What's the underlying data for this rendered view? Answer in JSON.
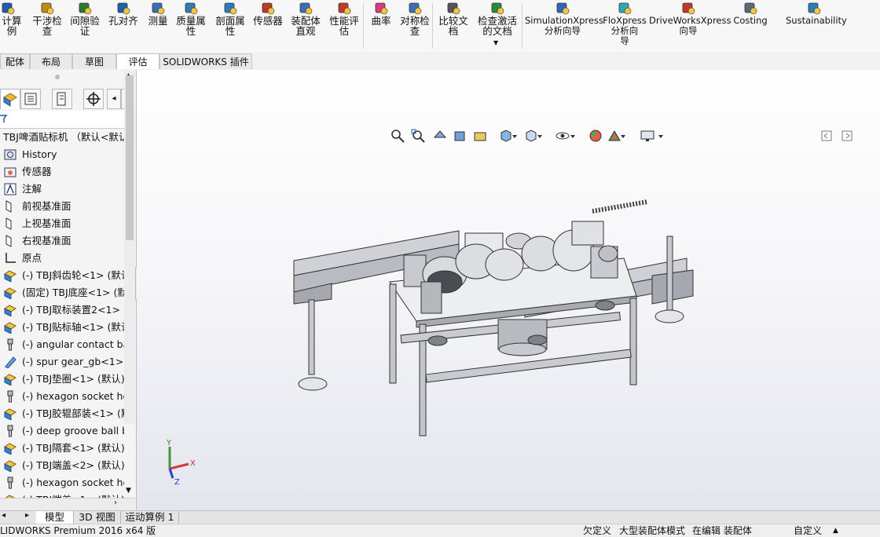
{
  "ribbon": {
    "items": [
      {
        "label": "计算\n例",
        "icon": "calc-icon",
        "color": "#1c5fae"
      },
      {
        "label": "干涉检\n查",
        "icon": "interference-icon",
        "color": "#c48a14"
      },
      {
        "label": "间隙验\n证",
        "icon": "clearance-icon",
        "color": "#2c7a2c"
      },
      {
        "label": "孔对齐",
        "icon": "hole-align-icon",
        "color": "#1c5fae"
      },
      {
        "label": "测量",
        "icon": "measure-icon",
        "color": "#3a6fb8"
      },
      {
        "label": "质量属\n性",
        "icon": "mass-properties-icon",
        "color": "#2c7ab8"
      },
      {
        "label": "剖面属\n性",
        "icon": "section-properties-icon",
        "color": "#2c7ab8"
      },
      {
        "label": "传感器",
        "icon": "sensor-icon",
        "color": "#b83c2c"
      },
      {
        "label": "装配体\n直观",
        "icon": "assembly-visualization-icon",
        "color": "#3a6fb8"
      },
      {
        "label": "性能评\n估",
        "icon": "performance-icon",
        "color": "#c0392b"
      },
      {
        "label": "曲率",
        "icon": "curvature-icon",
        "color": "#d83c7a"
      },
      {
        "label": "对称检\n查",
        "icon": "symmetry-check-icon",
        "color": "#3a6fb8"
      },
      {
        "label": "比较文\n档",
        "icon": "compare-documents-icon",
        "color": "#555555"
      },
      {
        "label": "检查激活\n的文档",
        "icon": "check-active-document-icon",
        "color": "#2c8a3c"
      },
      {
        "label": "SimulationXpress\n分析向导",
        "icon": "simulationxpress-icon",
        "color": "#2c6ab8"
      },
      {
        "label": "FloXpress\n分析向\n导",
        "icon": "floxpress-icon",
        "color": "#2ca8b8"
      },
      {
        "label": "DriveWorksXpress\n向导",
        "icon": "driveworksxpress-icon",
        "color": "#c0392b"
      },
      {
        "label": "Costing",
        "icon": "costing-icon",
        "color": "#5a6a7a"
      },
      {
        "label": "Sustainability",
        "icon": "sustainability-icon",
        "color": "#2c7ab8"
      }
    ]
  },
  "command_tabs": [
    "配体",
    "布局",
    "草图",
    "评估",
    "SOLIDWORKS 插件"
  ],
  "active_tab": "评估",
  "tree": {
    "root": "TBJ啤酒贴标机 （默认<默认_",
    "items": [
      {
        "label": "History",
        "icon": "history-icon"
      },
      {
        "label": "传感器",
        "icon": "sensor-folder-icon"
      },
      {
        "label": "注解",
        "icon": "annotations-icon"
      },
      {
        "label": "前视基准面",
        "icon": "plane-icon"
      },
      {
        "label": "上视基准面",
        "icon": "plane-icon"
      },
      {
        "label": "右视基准面",
        "icon": "plane-icon"
      },
      {
        "label": "原点",
        "icon": "origin-icon"
      },
      {
        "label": "(-) TBJ斜齿轮<1> (默认",
        "icon": "subassembly-icon"
      },
      {
        "label": "(固定) TBJ底座<1> (默认",
        "icon": "subassembly-icon"
      },
      {
        "label": "(-) TBJ取标装置2<1> (默",
        "icon": "subassembly-icon"
      },
      {
        "label": "(-) TBJ贴标轴<1> (默认",
        "icon": "subassembly-icon"
      },
      {
        "label": "(-) angular contact bal",
        "icon": "toolbox-part-icon"
      },
      {
        "label": "(-) spur gear_gb<1> (",
        "icon": "toolbox-gear-icon"
      },
      {
        "label": "(-) TBJ垫圈<1> (默认)",
        "icon": "subassembly-icon"
      },
      {
        "label": "(-) hexagon socket hea",
        "icon": "toolbox-part-icon"
      },
      {
        "label": "(-) TBJ胶辊部装<1> (默",
        "icon": "subassembly-icon"
      },
      {
        "label": "(-) deep groove ball b",
        "icon": "toolbox-part-icon"
      },
      {
        "label": "(-) TBJ隔套<1> (默认)",
        "icon": "subassembly-icon"
      },
      {
        "label": "(-) TBJ端盖<2> (默认)",
        "icon": "subassembly-icon"
      },
      {
        "label": "(-) hexagon socket hea",
        "icon": "toolbox-part-icon"
      },
      {
        "label": "(-) TBJ端盖<1> (默认)",
        "icon": "subassembly-icon"
      }
    ]
  },
  "bottom_tabs": [
    "模型",
    "3D 视图",
    "运动算例 1"
  ],
  "active_bottom_tab": "模型",
  "status": {
    "app": "LIDWORKS Premium 2016 x64 版",
    "underdefined": "欠定义",
    "large_assembly": "大型装配体模式",
    "editing": "在编辑 装配体",
    "units": "自定义"
  },
  "triad": {
    "x": "X",
    "y": "Y",
    "z": "Z"
  },
  "colors": {
    "accent": "#1c5fae",
    "viewport_top": "#ffffff",
    "viewport_bottom": "#e4e6ee"
  }
}
